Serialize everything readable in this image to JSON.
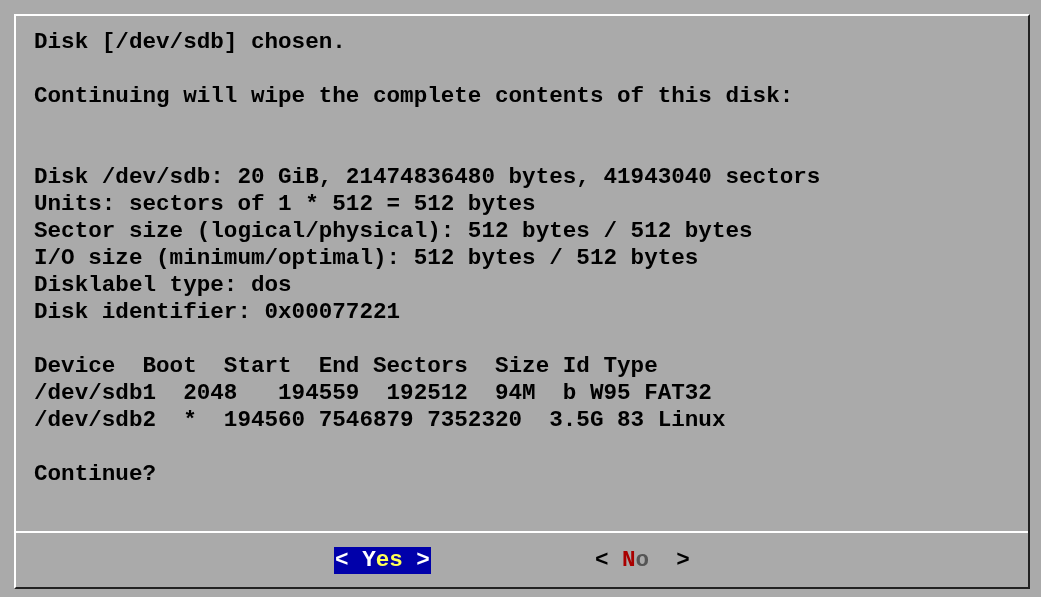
{
  "dialog": {
    "heading": "Disk [/dev/sdb] chosen.",
    "warning": "Continuing will wipe the complete contents of this disk:",
    "info": [
      "Disk /dev/sdb: 20 GiB, 21474836480 bytes, 41943040 sectors",
      "Units: sectors of 1 * 512 = 512 bytes",
      "Sector size (logical/physical): 512 bytes / 512 bytes",
      "I/O size (minimum/optimal): 512 bytes / 512 bytes",
      "Disklabel type: dos",
      "Disk identifier: 0x00077221"
    ],
    "table": {
      "header": "Device  Boot  Start  End Sectors  Size Id Type",
      "rows": [
        "/dev/sdb1  2048   194559  192512  94M  b W95 FAT32",
        "/dev/sdb2  *  194560 7546879 7352320  3.5G 83 Linux"
      ]
    },
    "prompt": "Continue?",
    "buttons": [
      {
        "left": "<",
        "label": "Yes",
        "right": ">",
        "selected": true
      },
      {
        "left": "<",
        "label": "No",
        "right": ">",
        "selected": false
      }
    ]
  }
}
